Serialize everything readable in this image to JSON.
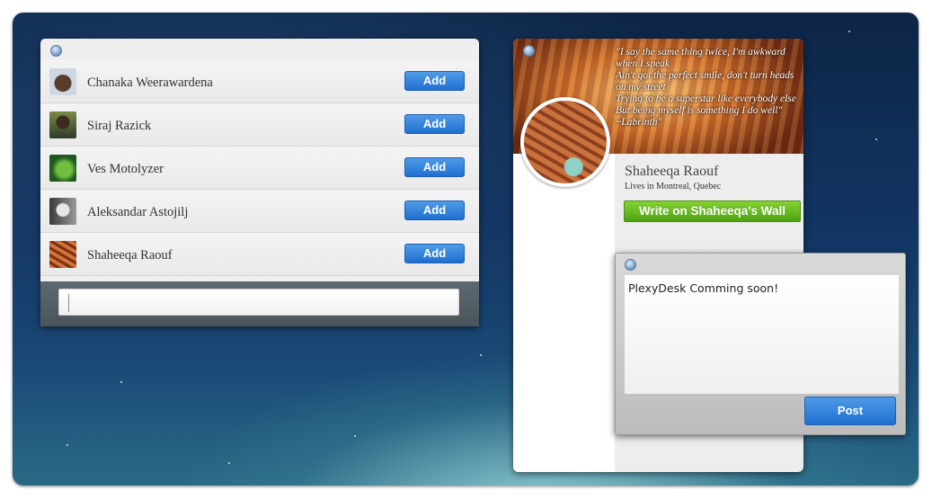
{
  "friends_window": {
    "friends": [
      {
        "name": "Chanaka Weerawardena",
        "add_label": "Add",
        "avatar_color": "#b7c3cf"
      },
      {
        "name": "Siraj Razick",
        "add_label": "Add",
        "avatar_color": "#5d6a3a"
      },
      {
        "name": "Ves Motolyzer",
        "add_label": "Add",
        "avatar_color": "#2f7a2c"
      },
      {
        "name": "Aleksandar Astojilj",
        "add_label": "Add",
        "avatar_color": "#8a8a8a"
      },
      {
        "name": "Shaheeqa Raouf",
        "add_label": "Add",
        "avatar_color": "#b34e22"
      }
    ],
    "search": {
      "value": "",
      "placeholder": ""
    }
  },
  "profile_window": {
    "quote": "\"I say the same thing twice, I'm awkward when I speak\nAin't got the perfect smile, don't turn heads on my street\nTrying to be a superstar like everybody else\nBut being myself is something I do well\" ~Labrinth\"",
    "name": "Shaheeqa Raouf",
    "lives_in": "Lives in  Montreal, Quebec",
    "wall_button": "Write on Shaheeqa's Wall"
  },
  "post_window": {
    "text": "PlexyDesk Comming soon!",
    "post_button": "Post"
  },
  "colors": {
    "accent_blue": "#2f7fdc",
    "accent_green": "#62b822"
  }
}
